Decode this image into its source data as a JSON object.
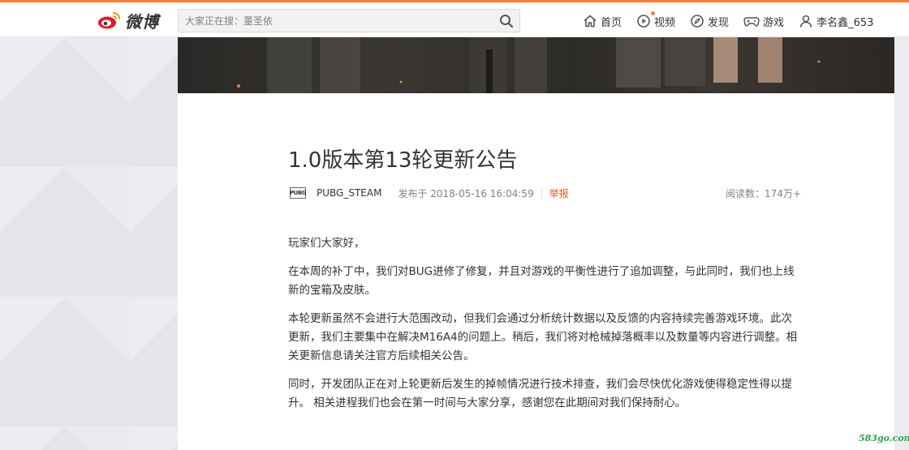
{
  "nav": {
    "logo_text": "微博",
    "search_placeholder": "大家正在搜：董圣依",
    "items": [
      {
        "label": "首页",
        "icon": "home-icon"
      },
      {
        "label": "视频",
        "icon": "video-icon"
      },
      {
        "label": "发现",
        "icon": "discover-icon"
      },
      {
        "label": "游戏",
        "icon": "game-icon"
      },
      {
        "label": "李名鑫_653",
        "icon": "user-icon"
      }
    ],
    "accent": "#fa7d3c"
  },
  "article": {
    "title": "1.0版本第13轮更新公告",
    "author_logo": "PUBG",
    "author": "PUBG_STEAM",
    "published": "发布于 2018-05-16 16:04:59",
    "report": "举报",
    "reads": "阅读数：174万+",
    "paragraphs": [
      "玩家们大家好，",
      "在本周的补丁中，我们对BUG进修了修复，并且对游戏的平衡性进行了追加调整，与此同时，我们也上线新的宝箱及皮肤。",
      "本轮更新虽然不会进行大范围改动，但我们会通过分析统计数据以及反馈的内容持续完善游戏环境。此次更新，我们主要集中在解决M16A4的问题上。稍后，我们将对枪械掉落概率以及数量等内容进行调整。相关更新信息请关注官方后续相关公告。",
      "同时，开发团队正在对上轮更新后发生的掉帧情况进行技术排查，我们会尽快优化游戏使得稳定性得以提升。 相关进程我们也会在第一时间与大家分享，感谢您在此期间对我们保持耐心。"
    ]
  },
  "watermark": "583go.com"
}
